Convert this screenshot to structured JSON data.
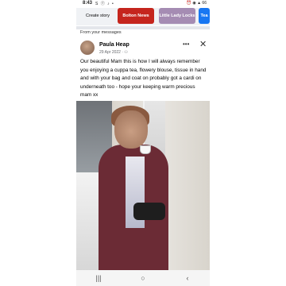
{
  "status": {
    "time": "8:43",
    "left_icons": "S ⓕ ♪ •",
    "right_icons": "⏰ ◉ ▲ 66"
  },
  "stories": {
    "create_label": "Create story",
    "items": [
      {
        "label": "Bolton News",
        "color": "#c5251d"
      },
      {
        "label": "Little Lady Locks",
        "color": "#a58cb3"
      },
      {
        "label": "Tea",
        "color": "#1877f2"
      }
    ]
  },
  "post": {
    "from_label": "From your messages",
    "author": "Paula Heap",
    "meta": "29 Apr 2022 · ",
    "text": "Our beautiful Mam this is how I will always remember you enjoying a cuppa tea, flowery blouse, tissue in hand and with your bag and coat on probably got a cardi on underneath too - hope your keeping warm precious mam xx",
    "more_icon": "more-options-icon",
    "close_icon": "close-icon"
  },
  "navbar": {
    "recent_icon": "recent-apps-icon",
    "home_icon": "home-icon",
    "back_icon": "back-icon"
  }
}
